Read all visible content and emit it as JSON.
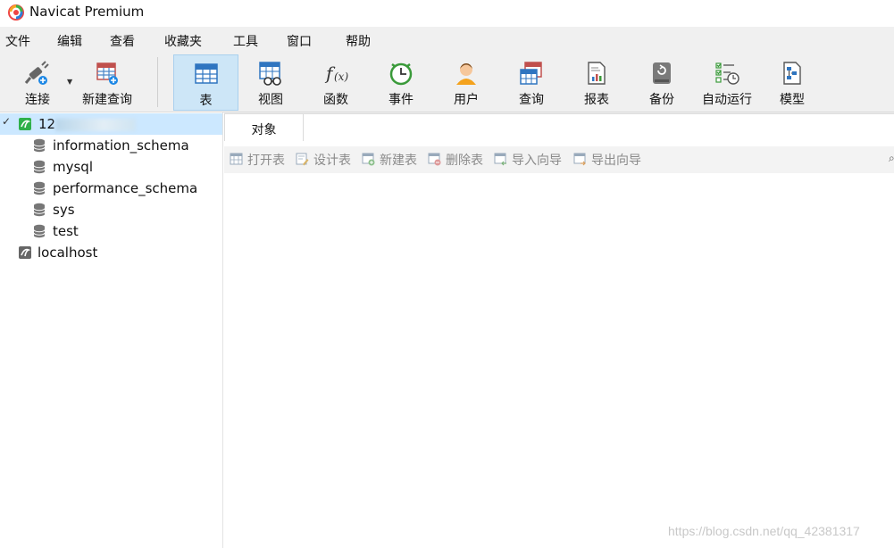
{
  "app": {
    "title": "Navicat Premium"
  },
  "menu": [
    "文件",
    "编辑",
    "查看",
    "收藏夹",
    "工具",
    "窗口",
    "帮助"
  ],
  "toolbar": {
    "connect": "连接",
    "new_query": "新建查询",
    "table": "表",
    "view": "视图",
    "function": "函数",
    "event": "事件",
    "user": "用户",
    "query": "查询",
    "report": "报表",
    "backup": "备份",
    "automation": "自动运行",
    "model": "模型"
  },
  "sidebar": {
    "connection": {
      "label": "12",
      "expanded": true
    },
    "databases": [
      "information_schema",
      "mysql",
      "performance_schema",
      "sys",
      "test"
    ],
    "other_connection": "localhost"
  },
  "tabs": {
    "objects": "对象"
  },
  "object_toolbar": [
    "打开表",
    "设计表",
    "新建表",
    "删除表",
    "导入向导",
    "导出向导"
  ],
  "watermark": "https://blog.csdn.net/qq_42381317",
  "colors": {
    "selected_row": "#cce8ff",
    "active_tool": "#cde6f7",
    "chrome": "#f0f0f0"
  }
}
